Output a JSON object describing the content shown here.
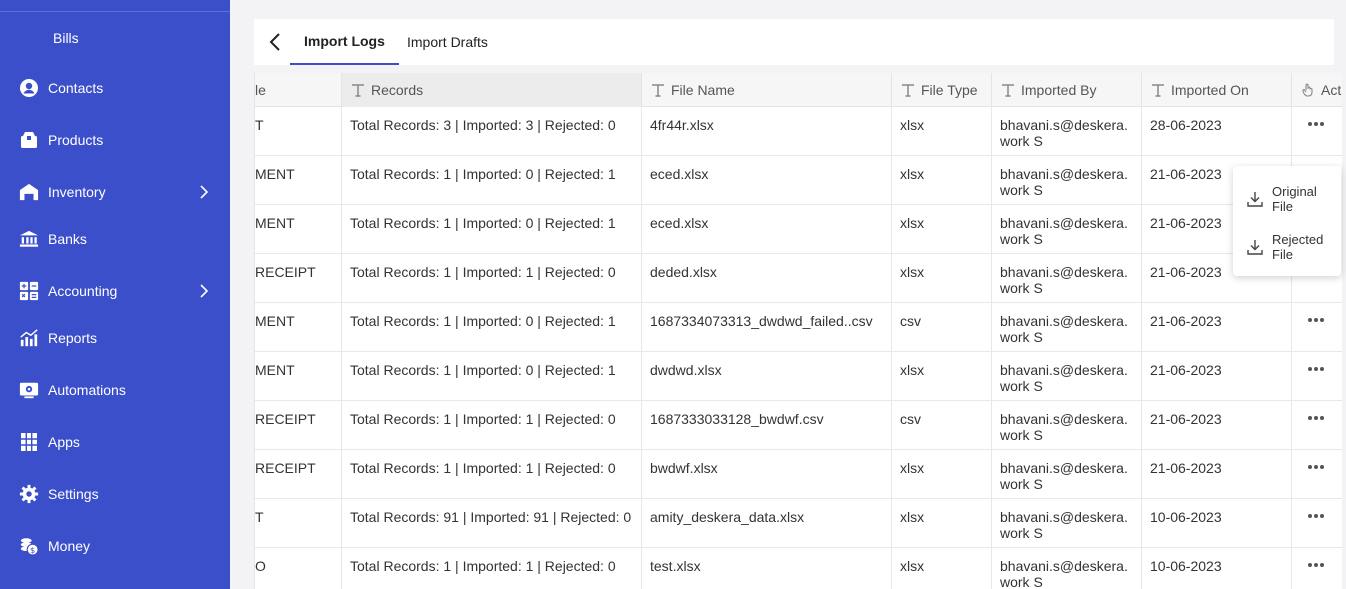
{
  "sidebar": {
    "items": [
      {
        "label": "Bills",
        "icon": "none"
      },
      {
        "label": "Contacts",
        "icon": "contact-icon"
      },
      {
        "label": "Products",
        "icon": "box-icon"
      },
      {
        "label": "Inventory",
        "icon": "warehouse-icon"
      },
      {
        "label": "Banks",
        "icon": "bank-icon"
      },
      {
        "label": "Accounting",
        "icon": "calculator-icon"
      },
      {
        "label": "Reports",
        "icon": "chart-icon"
      },
      {
        "label": "Automations",
        "icon": "automation-icon"
      },
      {
        "label": "Apps",
        "icon": "apps-grid-icon"
      },
      {
        "label": "Settings",
        "icon": "gear-icon"
      },
      {
        "label": "Money",
        "icon": "money-icon"
      }
    ],
    "bg_color": "#3a4fc9"
  },
  "tabs": {
    "items": [
      {
        "label": "Import Logs",
        "active": true
      },
      {
        "label": "Import Drafts",
        "active": false
      }
    ]
  },
  "table": {
    "headers": [
      "le",
      "Records",
      "File Name",
      "File Type",
      "Imported By",
      "Imported On",
      "Act"
    ],
    "rows": [
      {
        "module": "T",
        "records": "Total Records: 3 | Imported: 3 | Rejected: 0",
        "file": "4fr44r.xlsx",
        "type": "xlsx",
        "by": "bhavani.s@deskera.work S",
        "on": "28-06-2023"
      },
      {
        "module": "MENT",
        "records": "Total Records: 1 | Imported: 0 | Rejected: 1",
        "file": "eced.xlsx",
        "type": "xlsx",
        "by": "bhavani.s@deskera.work S",
        "on": "21-06-2023"
      },
      {
        "module": "MENT",
        "records": "Total Records: 1 | Imported: 0 | Rejected: 1",
        "file": "eced.xlsx",
        "type": "xlsx",
        "by": "bhavani.s@deskera.work S",
        "on": "21-06-2023"
      },
      {
        "module": "RECEIPT",
        "records": "Total Records: 1 | Imported: 1 | Rejected: 0",
        "file": "deded.xlsx",
        "type": "xlsx",
        "by": "bhavani.s@deskera.work S",
        "on": "21-06-2023"
      },
      {
        "module": "MENT",
        "records": "Total Records: 1 | Imported: 0 | Rejected: 1",
        "file": "1687334073313_dwdwd_failed..csv",
        "type": "csv",
        "by": "bhavani.s@deskera.work S",
        "on": "21-06-2023"
      },
      {
        "module": "MENT",
        "records": "Total Records: 1 | Imported: 0 | Rejected: 1",
        "file": "dwdwd.xlsx",
        "type": "xlsx",
        "by": "bhavani.s@deskera.work S",
        "on": "21-06-2023"
      },
      {
        "module": "RECEIPT",
        "records": "Total Records: 1 | Imported: 1 | Rejected: 0",
        "file": "1687333033128_bwdwf.csv",
        "type": "csv",
        "by": "bhavani.s@deskera.work S",
        "on": "21-06-2023"
      },
      {
        "module": "RECEIPT",
        "records": "Total Records: 1 | Imported: 1 | Rejected: 0",
        "file": "bwdwf.xlsx",
        "type": "xlsx",
        "by": "bhavani.s@deskera.work S",
        "on": "21-06-2023"
      },
      {
        "module": "T",
        "records": "Total Records: 91 | Imported: 91 | Rejected: 0",
        "file": "amity_deskera_data.xlsx",
        "type": "xlsx",
        "by": "bhavani.s@deskera.work S",
        "on": "10-06-2023"
      },
      {
        "module": "O",
        "records": "Total Records: 1 | Imported: 1 | Rejected: 0",
        "file": "test.xlsx",
        "type": "xlsx",
        "by": "bhavani.s@deskera.work S",
        "on": "10-06-2023"
      }
    ]
  },
  "menu": {
    "items": [
      {
        "label": "Original File",
        "icon": "download-icon"
      },
      {
        "label": "Rejected File",
        "icon": "download-icon"
      }
    ]
  }
}
